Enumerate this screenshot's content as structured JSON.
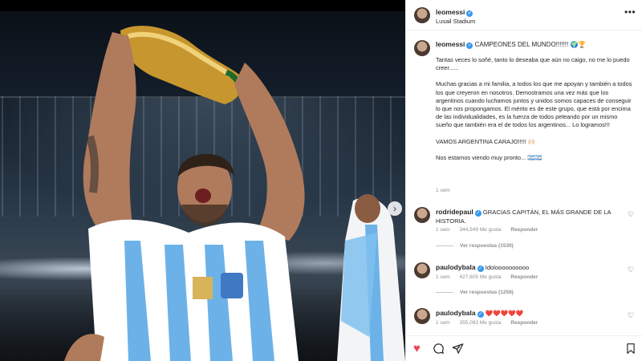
{
  "post": {
    "username": "leomessi",
    "location": "Lusail Stadium",
    "more_icon": "ellipsis-icon",
    "colors": {
      "verified": "#3897f0",
      "like_red": "#ed4956",
      "muted": "#8e8e8e"
    }
  },
  "caption": {
    "username": "leomessi",
    "headline": "CAMPEONES DEL MUNDO!!!!!!! 🌍🏆",
    "paragraphs": [
      "Tantas veces lo soñé, tanto lo deseaba que aún no caigo, no me lo puedo creer......",
      "Muchas gracias a mi familia, a todos los que me apoyan y también a todos los que creyeron en nosotros. Demostramos una vez más que los argentinos cuando luchamos juntos y unidos somos capaces de conseguir lo que nos propongamos. El mérito es de este grupo, que está por encima de las individualidades, es la fuerza de todos peleando por un mismo sueño que también era el de todos los argentinos... Lo logramos!!!",
      "VAMOS ARGENTINA CARAJO!!!!! 🙌🏻",
      "Nos estamos viendo muy pronto... 🇦🇷🇦🇷"
    ],
    "time": "1 sem"
  },
  "comments": [
    {
      "username": "rodridepaul",
      "text": "GRACIAS CAPITÁN, EL MÁS GRANDE DE LA HISTORIA.",
      "time": "1 sem",
      "likes": "344,949 Me gusta",
      "reply": "Responder",
      "view_replies": "Ver respuestas (1530)"
    },
    {
      "username": "paulodybala",
      "text": "Idoloooooooooo",
      "time": "1 sem",
      "likes": "427,605 Me gusta",
      "reply": "Responder",
      "view_replies": "Ver respuestas (1256)"
    },
    {
      "username": "paulodybala",
      "text": "❤️❤️❤️❤️❤️",
      "time": "1 sem",
      "likes": "355,093 Me gusta",
      "reply": "Responder",
      "view_replies": ""
    }
  ],
  "footer": {
    "icons": [
      "heart-filled-icon",
      "comment-icon",
      "share-icon",
      "bookmark-icon"
    ]
  }
}
